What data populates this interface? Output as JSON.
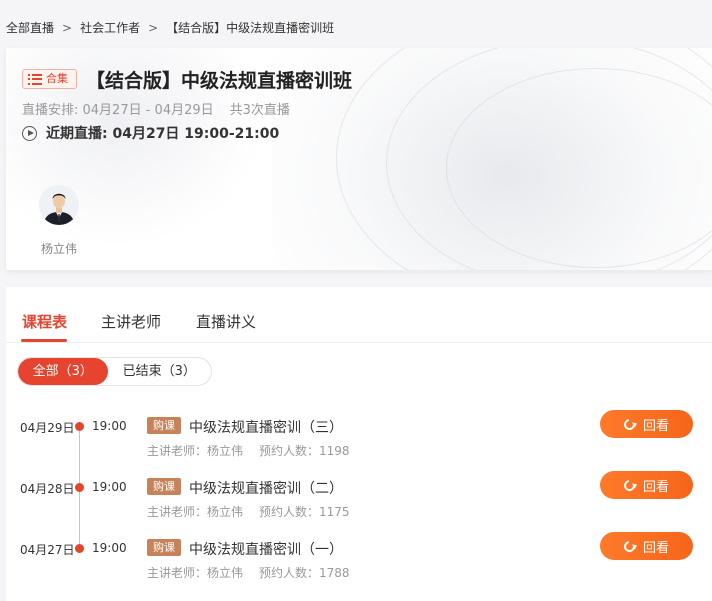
{
  "breadcrumb": {
    "items": [
      "全部直播",
      "社会工作者",
      "【结合版】中级法规直播密训班"
    ],
    "separator": ">"
  },
  "course": {
    "badge_label": "合集",
    "badge_icon": "list-icon",
    "title": "【结合版】中级法规直播密训班",
    "schedule_text": "直播安排: 04月27日 - 04月29日",
    "session_count_text": "共3次直播",
    "next_live_text": "近期直播: 04月27日 19:00-21:00",
    "next_live_icon": "play-circle-icon"
  },
  "teacher": {
    "name": "杨立伟"
  },
  "tabs": [
    {
      "label": "课程表",
      "active": true
    },
    {
      "label": "主讲老师",
      "active": false
    },
    {
      "label": "直播讲义",
      "active": false
    }
  ],
  "filters": [
    {
      "label": "全部（3）",
      "active": true
    },
    {
      "label": "已结束（3）",
      "active": false
    }
  ],
  "sessions": [
    {
      "date": "04月29日",
      "time": "19:00",
      "tag": "购课",
      "title": "中级法规直播密训（三）",
      "teacher_text": "主讲老师：杨立伟",
      "reservations_text": "预约人数：1198",
      "action_label": "回看"
    },
    {
      "date": "04月28日",
      "time": "19:00",
      "tag": "购课",
      "title": "中级法规直播密训（二）",
      "teacher_text": "主讲老师：杨立伟",
      "reservations_text": "预约人数：1175",
      "action_label": "回看"
    },
    {
      "date": "04月27日",
      "time": "19:00",
      "tag": "购课",
      "title": "中级法规直播密训（一）",
      "teacher_text": "主讲老师：杨立伟",
      "reservations_text": "预约人数：1788",
      "action_label": "回看"
    }
  ],
  "colors": {
    "accent": "#e6442e",
    "replay_button": "#f76d22",
    "tag": "#c8825a"
  }
}
